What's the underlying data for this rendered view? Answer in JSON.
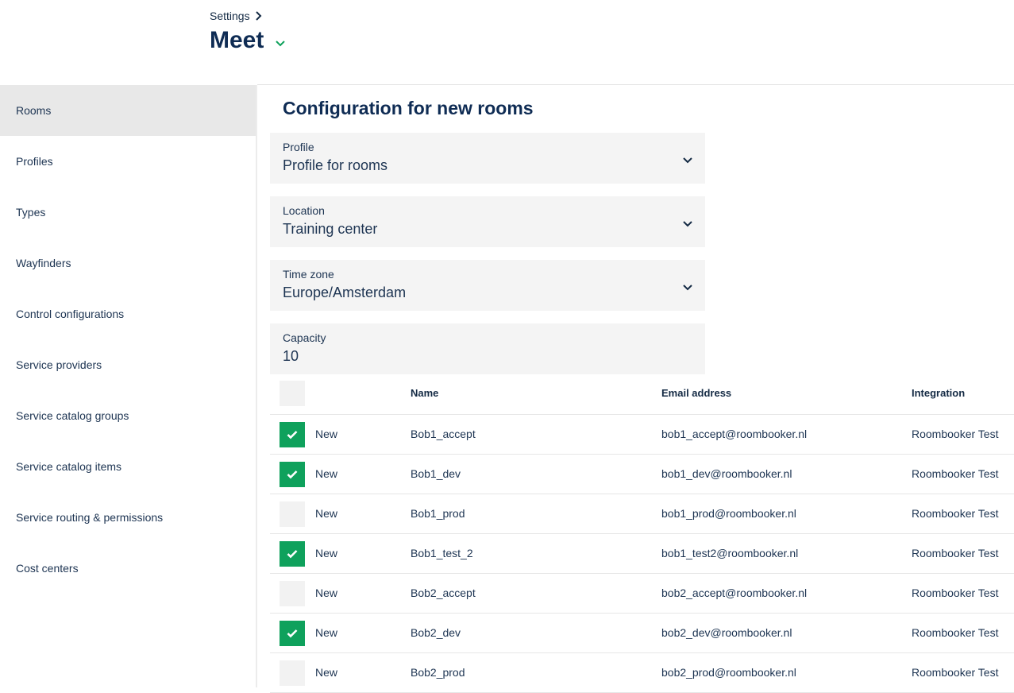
{
  "header": {
    "breadcrumb": "Settings",
    "title": "Meet"
  },
  "sidebar": {
    "items": [
      {
        "label": "Rooms",
        "active": true
      },
      {
        "label": "Profiles"
      },
      {
        "label": "Types"
      },
      {
        "label": "Wayfinders"
      },
      {
        "label": "Control configurations"
      },
      {
        "label": "Service providers"
      },
      {
        "label": "Service catalog groups"
      },
      {
        "label": "Service catalog items"
      },
      {
        "label": "Service routing & permissions"
      },
      {
        "label": "Cost centers"
      }
    ]
  },
  "main": {
    "section_title": "Configuration for new rooms",
    "fields": {
      "profile": {
        "label": "Profile",
        "value": "Profile for rooms"
      },
      "location": {
        "label": "Location",
        "value": "Training center"
      },
      "timezone": {
        "label": "Time zone",
        "value": "Europe/Amsterdam"
      },
      "capacity": {
        "label": "Capacity",
        "value": "10"
      }
    }
  },
  "table": {
    "columns": {
      "name": "Name",
      "email": "Email address",
      "integration": "Integration"
    },
    "rows": [
      {
        "checked": true,
        "status": "New",
        "name": "Bob1_accept",
        "email": "bob1_accept@roombooker.nl",
        "integration": "Roombooker Test"
      },
      {
        "checked": true,
        "status": "New",
        "name": "Bob1_dev",
        "email": "bob1_dev@roombooker.nl",
        "integration": "Roombooker Test"
      },
      {
        "checked": false,
        "status": "New",
        "name": "Bob1_prod",
        "email": "bob1_prod@roombooker.nl",
        "integration": "Roombooker Test"
      },
      {
        "checked": true,
        "status": "New",
        "name": "Bob1_test_2",
        "email": "bob1_test2@roombooker.nl",
        "integration": "Roombooker Test"
      },
      {
        "checked": false,
        "status": "New",
        "name": "Bob2_accept",
        "email": "bob2_accept@roombooker.nl",
        "integration": "Roombooker Test"
      },
      {
        "checked": true,
        "status": "New",
        "name": "Bob2_dev",
        "email": "bob2_dev@roombooker.nl",
        "integration": "Roombooker Test"
      },
      {
        "checked": false,
        "status": "New",
        "name": "Bob2_prod",
        "email": "bob2_prod@roombooker.nl",
        "integration": "Roombooker Test"
      }
    ]
  },
  "colors": {
    "accent": "#0fa15c",
    "primary": "#0f2c54"
  },
  "icons": {
    "breadcrumb": "chevron-right-icon",
    "title": "chevron-down-icon",
    "dropdown": "chevron-down-icon",
    "check": "check-icon"
  }
}
